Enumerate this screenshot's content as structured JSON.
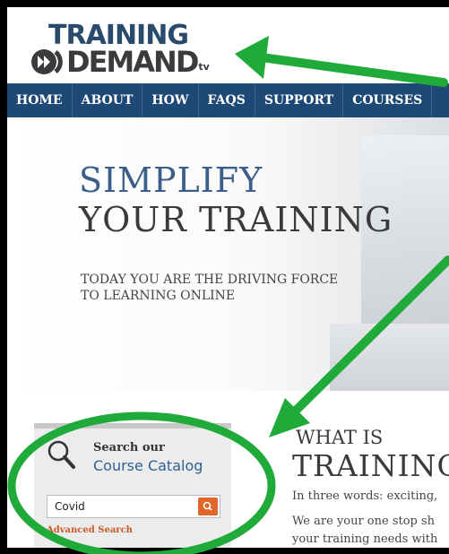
{
  "logo": {
    "line1": "TRAINING",
    "line2": "DEMAND",
    "suffix": "tv"
  },
  "nav": {
    "items": [
      "HOME",
      "ABOUT",
      "HOW",
      "FAQS",
      "SUPPORT",
      "COURSES"
    ]
  },
  "hero": {
    "title_line1": "SIMPLIFY",
    "title_line2": "YOUR TRAINING",
    "subtitle_line1": "TODAY YOU ARE THE DRIVING FORCE",
    "subtitle_line2": "TO LEARNING ONLINE"
  },
  "search": {
    "label_line1": "Search our",
    "label_line2": "Course Catalog",
    "input_value": "Covid",
    "advanced_link": "Advanced Search"
  },
  "about": {
    "heading_small": "WHAT IS",
    "heading_large": "TRAINING",
    "intro_line1": "In three words: exciting,",
    "intro_line2": "We are your one stop sh",
    "intro_line3": "your training needs with"
  },
  "colors": {
    "nav_bg": "#1e4976",
    "annotation_green": "#1faa3a",
    "search_button": "#e0662a",
    "brand_blue": "#2a4a6b"
  }
}
